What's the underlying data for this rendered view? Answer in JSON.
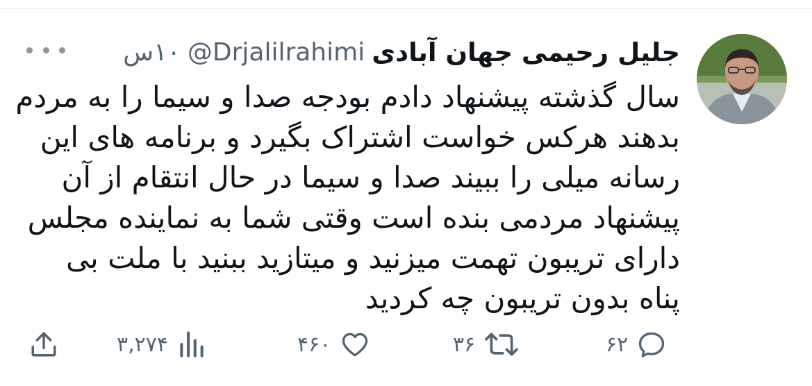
{
  "tweet": {
    "author": {
      "display_name": "جلیل رحیمی جهان آبادی",
      "handle": "@Drjalilrahimi",
      "time": "۱۰س"
    },
    "text_lines": [
      "سال گذشته پیشنهاد دادم بودجه صدا و سیما را به مردم",
      "بدهند هرکس خواست  اشتراک بگیرد و برنامه های این",
      "رسانه میلی را ببیند صدا و سیما در حال انتقام از آن",
      "پیشنهاد مردمی بنده است وقتی شما به نماینده مجلس",
      "دارای تریبون تهمت میزنید و میتازید ببنید با ملت بی",
      "پناه بدون تریبون چه کردید"
    ],
    "actions": {
      "replies": "۶۲",
      "retweets": "۳۶",
      "likes": "۴۶۰",
      "views": "۳,۲۷۴"
    },
    "icons": {
      "reply": "reply-icon",
      "retweet": "retweet-icon",
      "like": "heart-icon",
      "views": "analytics-icon",
      "share": "share-icon",
      "more": "more-icon"
    },
    "colors": {
      "text": "#0f1419",
      "secondary": "#536471",
      "more_dots": "#8b98a5"
    }
  }
}
